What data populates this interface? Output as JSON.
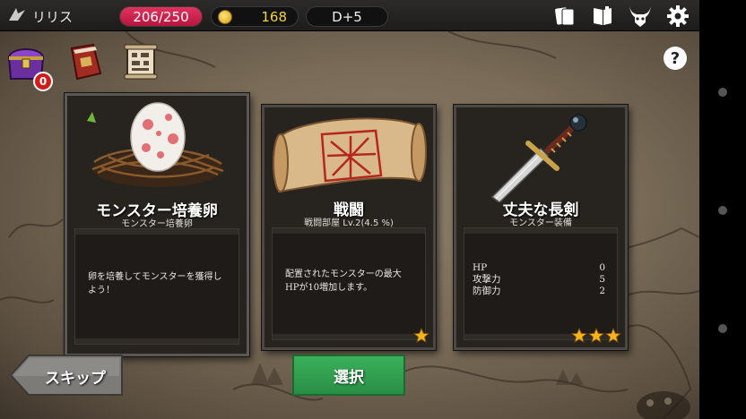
{
  "header": {
    "player_name": "リリス",
    "hp": "206/250",
    "gold": "168",
    "day": "D+5",
    "icons": [
      "cards-icon",
      "book-icon",
      "demon-head-icon",
      "gear-icon"
    ]
  },
  "sidebar": {
    "chest_badge": "0",
    "items": [
      "treasure-chest-icon",
      "spellbook-icon",
      "scroll-map-icon"
    ],
    "help_label": "?"
  },
  "cards": [
    {
      "title": "モンスター培養卵",
      "subtitle": "モンスター培養卵",
      "description": "卵を培養してモンスターを獲得しよう！",
      "image": "monster-egg-icon",
      "stars": 0
    },
    {
      "title": "戦闘",
      "subtitle": "戦闘部屋 Lv.2(4.5 %)",
      "description": "配置されたモンスターの最大HPが10増加します。",
      "image": "battle-scroll-icon",
      "stars": 1
    },
    {
      "title": "丈夫な長剣",
      "subtitle": "モンスター装備",
      "stats": [
        {
          "label": "HP",
          "value": "0"
        },
        {
          "label": "攻撃力",
          "value": "5"
        },
        {
          "label": "防御力",
          "value": "2"
        }
      ],
      "image": "long-sword-icon",
      "stars": 3
    }
  ],
  "buttons": {
    "skip": "スキップ",
    "select": "選択"
  },
  "colors": {
    "hp_bar": "#d0224a",
    "gold_text": "#f4d23c",
    "select_button": "#33a050",
    "star": "#f2b31f"
  }
}
